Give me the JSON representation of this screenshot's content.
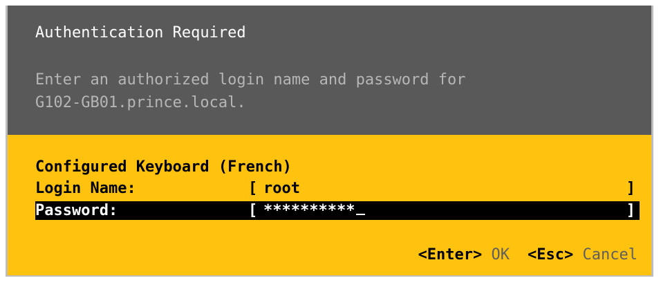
{
  "dialog": {
    "title": "Authentication Required",
    "message_line1": "Enter an authorized login name and password for",
    "message_line2": "G102-GB01.prince.local.",
    "keyboard_line": "Configured Keyboard (French)"
  },
  "fields": {
    "login_label": "Login Name:",
    "login_value": "root",
    "password_label": "Password:",
    "password_value": "**********"
  },
  "brackets": {
    "open": "[",
    "close": "]"
  },
  "footer": {
    "enter_key": "<Enter>",
    "ok_label": "OK",
    "esc_key": "<Esc>",
    "cancel_label": "Cancel"
  },
  "colors": {
    "header_bg": "#595959",
    "body_bg": "#ffc20e",
    "title_text": "#ffffff",
    "message_text": "#b6b6b6",
    "selected_row_bg": "#000000"
  }
}
